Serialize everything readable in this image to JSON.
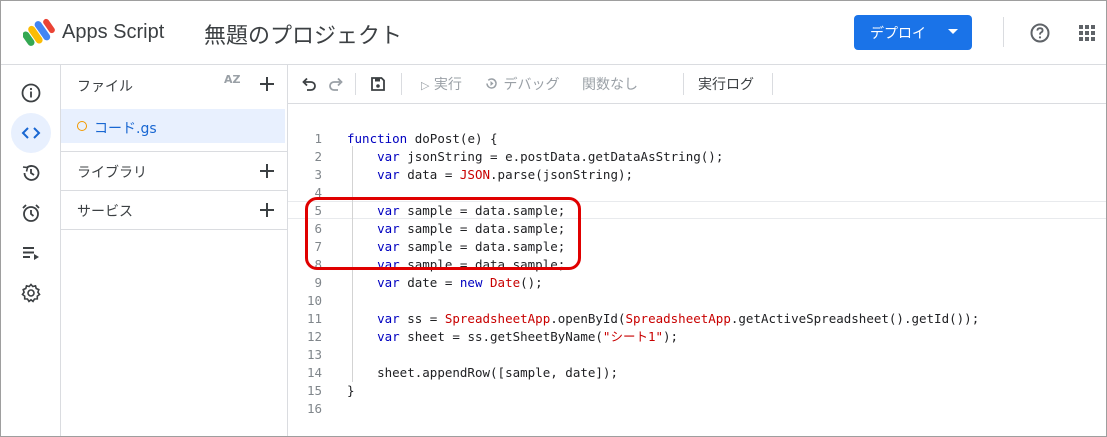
{
  "header": {
    "app_name": "Apps Script",
    "project_title": "無題のプロジェクト",
    "deploy_label": "デプロイ"
  },
  "rail": {
    "items": [
      "overview-icon",
      "editor-icon",
      "history-icon",
      "triggers-icon",
      "executions-icon",
      "settings-icon"
    ],
    "active": "editor-icon"
  },
  "files": {
    "header_label": "ファイル",
    "sort_label": "AZ",
    "items": [
      {
        "name": "コード.gs",
        "selected": true
      }
    ],
    "libraries_label": "ライブラリ",
    "services_label": "サービス"
  },
  "toolbar": {
    "run_label": "実行",
    "debug_label": "デバッグ",
    "function_select": "関数なし",
    "log_label": "実行ログ"
  },
  "editor": {
    "line_numbers": [
      "1",
      "2",
      "3",
      "4",
      "5",
      "6",
      "7",
      "8",
      "9",
      "10",
      "11",
      "12",
      "13",
      "14",
      "15",
      "16"
    ],
    "lines": [
      "function doPost(e) {",
      "    var jsonString = e.postData.getDataAsString();",
      "    var data = JSON.parse(jsonString);",
      "",
      "    var sample = data.sample;",
      "    var sample = data.sample;",
      "    var sample = data.sample;",
      "    var sample = data.sample;",
      "    var date = new Date();",
      "",
      "    var ss = SpreadsheetApp.openById(SpreadsheetApp.getActiveSpreadsheet().getId());",
      "    var sheet = ss.getSheetByName(\"シート1\");",
      "",
      "    sheet.appendRow([sample, date]);",
      "}",
      ""
    ],
    "highlight_color": "#e00000"
  },
  "colors": {
    "accent": "#1a73e8",
    "keyword": "#0000c0",
    "builtin": "#c80000"
  }
}
